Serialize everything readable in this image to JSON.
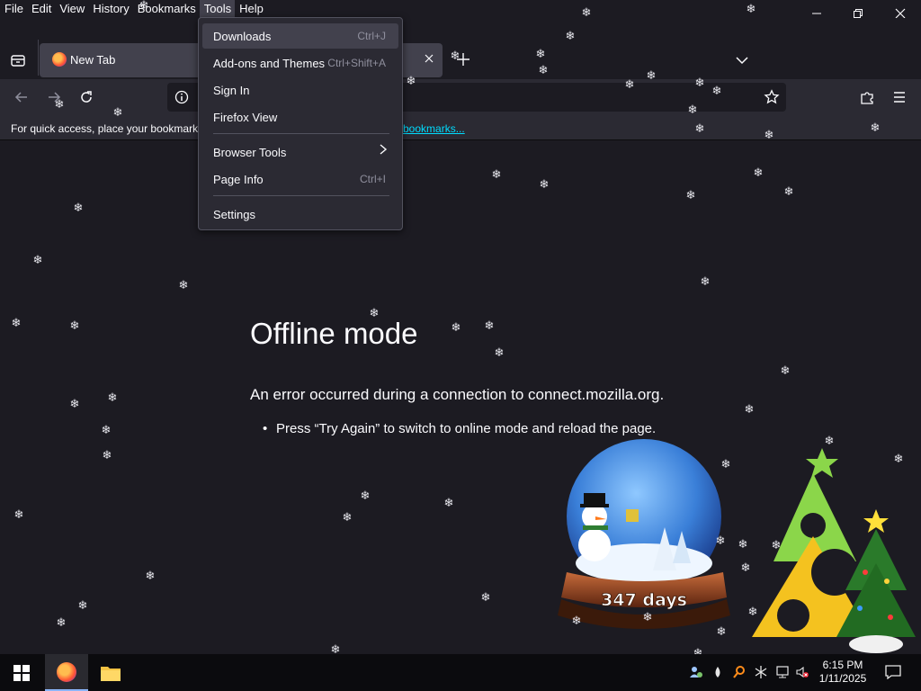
{
  "menubar": {
    "items": [
      "File",
      "Edit",
      "View",
      "History",
      "Bookmarks",
      "Tools",
      "Help"
    ],
    "active": "Tools"
  },
  "tabs": [
    {
      "title": "New Tab"
    }
  ],
  "bookmarks_bar": {
    "text": "For quick access, place your bookmarks",
    "link": "bookmarks..."
  },
  "tools_menu": {
    "items": [
      {
        "label": "Downloads",
        "accel": "Ctrl+J"
      },
      {
        "label": "Add-ons and Themes",
        "accel": "Ctrl+Shift+A"
      },
      {
        "label": "Sign In",
        "accel": ""
      },
      {
        "label": "Firefox View",
        "accel": ""
      },
      {
        "label": "Browser Tools",
        "accel": ""
      },
      {
        "label": "Page Info",
        "accel": "Ctrl+I"
      },
      {
        "label": "Settings",
        "accel": ""
      }
    ]
  },
  "page": {
    "title": "Offline mode",
    "description": "An error occurred during a connection to connect.mozilla.org.",
    "bullet": "Press “Try Again” to switch to online mode and reload the page."
  },
  "widget": {
    "globe_days": "347 days"
  },
  "taskbar": {
    "time": "6:15 PM",
    "date": "1/11/2025"
  },
  "colors": {
    "background": "#1c1b22",
    "toolbar": "#2b2a33",
    "menu_hover": "#42414d",
    "link": "#00ddff"
  }
}
